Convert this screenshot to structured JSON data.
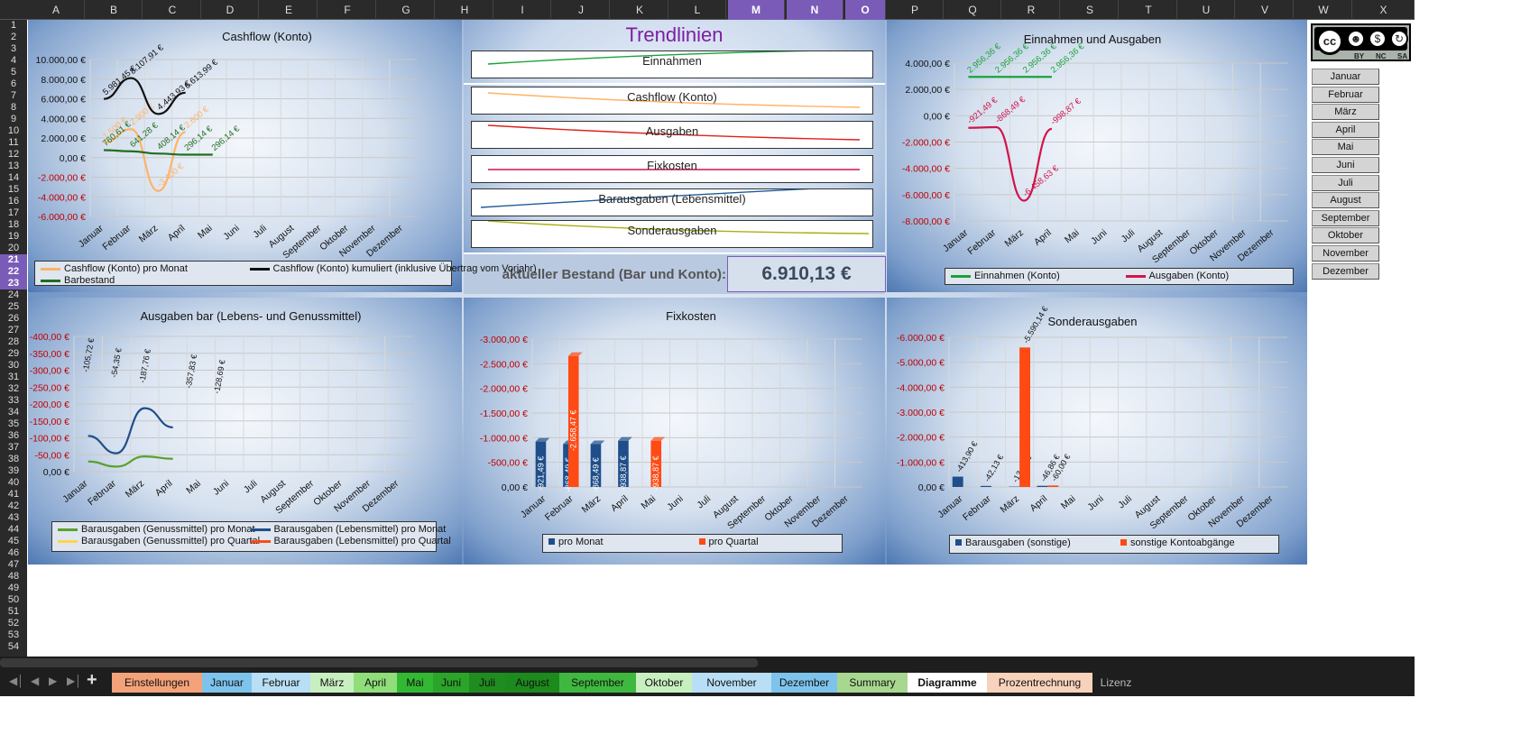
{
  "columns": [
    "A",
    "B",
    "C",
    "D",
    "E",
    "F",
    "G",
    "H",
    "I",
    "J",
    "K",
    "L",
    "M",
    "N",
    "O",
    "P",
    "Q",
    "R",
    "S",
    "T",
    "U",
    "V",
    "W",
    "X"
  ],
  "selected_columns": [
    "M",
    "N",
    "O"
  ],
  "rows": [
    "1",
    "2",
    "3",
    "4",
    "5",
    "6",
    "7",
    "8",
    "9",
    "10",
    "11",
    "12",
    "13",
    "14",
    "15",
    "16",
    "17",
    "18",
    "19",
    "20",
    "21",
    "22",
    "23",
    "24",
    "25",
    "26",
    "27",
    "28",
    "29",
    "30",
    "31",
    "32",
    "33",
    "34",
    "35",
    "36",
    "37",
    "38",
    "39",
    "40",
    "41",
    "42",
    "43",
    "44",
    "45",
    "46",
    "47",
    "48",
    "49",
    "50",
    "51",
    "52",
    "53",
    "54"
  ],
  "selected_rows": [
    "21",
    "22",
    "23"
  ],
  "months": [
    "Januar",
    "Februar",
    "März",
    "April",
    "Mai",
    "Juni",
    "Juli",
    "August",
    "September",
    "Oktober",
    "November",
    "Dezember"
  ],
  "trend": {
    "title": "Trendlinien",
    "items": [
      {
        "label": "Einnahmen",
        "color": "#1aa33a"
      },
      {
        "label": "Cashflow (Konto)",
        "color": "#ffb366"
      },
      {
        "label": "Ausgaben",
        "color": "#e0201c"
      },
      {
        "label": "Fixkosten",
        "color": "#d0144c"
      },
      {
        "label": "Barausgaben (Lebensmittel)",
        "color": "#1f5a9a"
      },
      {
        "label": "Sonderausgaben",
        "color": "#a8b010"
      }
    ],
    "balance_label": "aktueller Bestand (Bar und Konto):",
    "balance_value": "6.910,13 €"
  },
  "colors": {
    "selected_header": "#7a5cb8",
    "header_bg": "#2a2a2a",
    "dashboard_blue": "#3d6aa8"
  },
  "license": {
    "icon": "cc-by-nc-sa-icon",
    "labels": [
      "BY",
      "NC",
      "SA"
    ]
  },
  "chart_data": [
    {
      "type": "line",
      "title": "Cashflow (Konto)",
      "categories": [
        "Januar",
        "Februar",
        "März",
        "April",
        "Mai",
        "Juni",
        "Juli",
        "August",
        "September",
        "Oktober",
        "November",
        "Dezember"
      ],
      "yticks": [
        "10.000,00 €",
        "8.000,00 €",
        "6.000,00 €",
        "4.000,00 €",
        "2.000,00 €",
        "0,00 €",
        "-2.000,00 €",
        "-4.000,00 €",
        "-6.000,00 €"
      ],
      "ylim": [
        -6000,
        10000
      ],
      "series": [
        {
          "name": "Cashflow (Konto) pro Monat",
          "color": "#ffb366",
          "values": [
            1500,
            2900,
            -3400,
            2600
          ],
          "labels": [
            "1.500 €",
            "2.900 €",
            "-3.400 €",
            "2.600 €"
          ]
        },
        {
          "name": "Cashflow (Konto) kumuliert (inklusive Übertrag vom Vorjahr)",
          "color": "#111111",
          "values": [
            5981.45,
            8107.91,
            4443.93,
            6613.99
          ],
          "labels": [
            "5.981,45 €",
            "8.107,91 €",
            "4.443,93 €",
            "6.613,99 €"
          ]
        },
        {
          "name": "Barbestand",
          "color": "#1f6e1f",
          "values": [
            760.61,
            641.28,
            408.14,
            296.14,
            296.14
          ],
          "labels": [
            "760,61 €",
            "641,28 €",
            "408,14 €",
            "296,14 €",
            "296,14 €"
          ]
        }
      ],
      "legend": "bottom"
    },
    {
      "type": "line",
      "title": "Einnahmen und Ausgaben",
      "categories": [
        "Januar",
        "Februar",
        "März",
        "April",
        "Mai",
        "Juni",
        "Juli",
        "August",
        "September",
        "Oktober",
        "November",
        "Dezember"
      ],
      "yticks": [
        "4.000,00 €",
        "2.000,00 €",
        "0,00 €",
        "-2.000,00 €",
        "-4.000,00 €",
        "-6.000,00 €",
        "-8.000,00 €"
      ],
      "ylim": [
        -8000,
        4000
      ],
      "series": [
        {
          "name": "Einnahmen (Konto)",
          "color": "#1aa33a",
          "values": [
            2956.36,
            2956.36,
            2956.36,
            2956.36
          ],
          "labels": [
            "2.956,36 €",
            "2.956,36 €",
            "2.956,36 €",
            "2.956,36 €"
          ]
        },
        {
          "name": "Ausgaben (Konto)",
          "color": "#d0144c",
          "values": [
            -921.49,
            -868.49,
            -6458.63,
            -998.87
          ],
          "labels": [
            "-921,49 €",
            "-868,49 €",
            "-6.458,63 €",
            "-998,87 €"
          ]
        }
      ],
      "legend": "bottom"
    },
    {
      "type": "line",
      "title": "Ausgaben bar (Lebens- und Genussmittel)",
      "categories": [
        "Januar",
        "Februar",
        "März",
        "April",
        "Mai",
        "Juni",
        "Juli",
        "August",
        "September",
        "Oktober",
        "November",
        "Dezember"
      ],
      "yticks": [
        "-400,00 €",
        "-350,00 €",
        "-300,00 €",
        "-250,00 €",
        "-200,00 €",
        "-150,00 €",
        "-100,00 €",
        "-50,00 €",
        "0,00 €"
      ],
      "ylim": [
        0,
        -400
      ],
      "series": [
        {
          "name": "Barausgaben (Genussmittel) pro Monat",
          "color": "#5aa02c",
          "values": [
            -30,
            -15,
            -45,
            -38
          ]
        },
        {
          "name": "Barausgaben (Lebensmittel) pro Monat",
          "color": "#1f4e8a",
          "values": [
            -105.72,
            -54.35,
            -187.76,
            -131
          ]
        },
        {
          "name": "Barausgaben (Genussmittel) pro Quartal",
          "color": "#ffd34d",
          "values": []
        },
        {
          "name": "Barausgaben (Lebensmittel) pro Quartal",
          "color": "#ff4a14",
          "values": []
        }
      ],
      "annotations": [
        "-105,72 €",
        "-54,35 €",
        "-187,76 €",
        "-357,83 €",
        "-128,69 €"
      ],
      "legend": "bottom"
    },
    {
      "type": "bar",
      "title": "Fixkosten",
      "categories": [
        "Januar",
        "Februar",
        "März",
        "April",
        "Mai",
        "Juni",
        "Juli",
        "August",
        "September",
        "Oktober",
        "November",
        "Dezember"
      ],
      "yticks": [
        "-3.000,00 €",
        "-2.500,00 €",
        "-2.000,00 €",
        "-1.500,00 €",
        "-1.000,00 €",
        "-500,00 €",
        "0,00 €"
      ],
      "ylim": [
        0,
        -3000
      ],
      "series": [
        {
          "name": "pro Monat",
          "color": "#1f4e8a",
          "values": [
            -921.49,
            -868.49,
            -868.49,
            -938.87
          ],
          "labels": [
            "-921,49 €",
            "-868,49 €",
            "-868,49 €",
            "-938,87 €"
          ]
        },
        {
          "name": "pro Quartal",
          "color": "#ff4a14",
          "values": [
            null,
            -2658.47,
            null,
            null,
            -938.87
          ],
          "labels": [
            "",
            "-2.658,47 €",
            "",
            "",
            "-938,87 €"
          ]
        }
      ],
      "legend": "bottom"
    },
    {
      "type": "bar",
      "title": "Sonderausgaben",
      "categories": [
        "Januar",
        "Februar",
        "März",
        "April",
        "Mai",
        "Juni",
        "Juli",
        "August",
        "September",
        "Oktober",
        "November",
        "Dezember"
      ],
      "yticks": [
        "-6.000,00 €",
        "-5.000,00 €",
        "-4.000,00 €",
        "-3.000,00 €",
        "-2.000,00 €",
        "-1.000,00 €",
        "0,00 €"
      ],
      "ylim": [
        0,
        -6000
      ],
      "series": [
        {
          "name": "Barausgaben (sonstige)",
          "color": "#1f4e8a",
          "values": [
            -413.9,
            -42.13,
            -13.94,
            -46.86
          ],
          "labels": [
            "-413,90 €",
            "-42,13 €",
            "-13,94 €",
            "-46,86 €"
          ]
        },
        {
          "name": "sonstige Kontoabgänge",
          "color": "#ff4a14",
          "values": [
            null,
            null,
            -5590.14,
            -60
          ],
          "labels": [
            "",
            "",
            "-5.590,14 €",
            "-60,00 €"
          ]
        }
      ],
      "legend": "bottom"
    }
  ],
  "sheet_tabs": [
    {
      "label": "Einstellungen",
      "bg": "#f4a27a"
    },
    {
      "label": "Januar",
      "bg": "#7ec3ec"
    },
    {
      "label": "Februar",
      "bg": "#b8dff5"
    },
    {
      "label": "März",
      "bg": "#c8efc0"
    },
    {
      "label": "April",
      "bg": "#8fde7a"
    },
    {
      "label": "Mai",
      "bg": "#33b833"
    },
    {
      "label": "Juni",
      "bg": "#2aa52a"
    },
    {
      "label": "Juli",
      "bg": "#1f8c1f"
    },
    {
      "label": "August",
      "bg": "#1c8a1c"
    },
    {
      "label": "September",
      "bg": "#3fb83f"
    },
    {
      "label": "Oktober",
      "bg": "#c8efc0"
    },
    {
      "label": "November",
      "bg": "#b8dff5"
    },
    {
      "label": "Dezember",
      "bg": "#7ec3ec"
    },
    {
      "label": "Summary",
      "bg": "#a8d890"
    },
    {
      "label": "Diagramme",
      "bg": "#ffffff"
    },
    {
      "label": "Prozentrechnung",
      "bg": "#f9d2bc"
    },
    {
      "label": "Lizenz",
      "bg": "#1e1e1e"
    }
  ]
}
